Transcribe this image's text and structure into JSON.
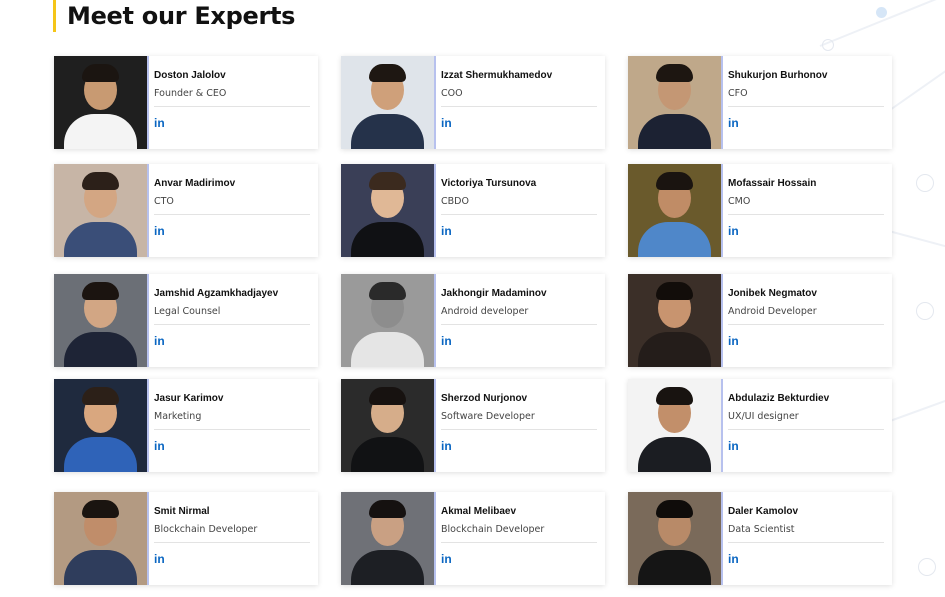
{
  "section": {
    "title": "Meet our Experts"
  },
  "linkedin_icon_text": "in",
  "experts": [
    {
      "name": "Doston Jalolov",
      "role": "Founder & CEO",
      "photo": {
        "bg": "#1f1f1f",
        "body": "#f4f4f4",
        "skin": "#c89a72",
        "hair": "#1b1511"
      }
    },
    {
      "name": "Izzat Shermukhamedov",
      "role": "COO",
      "photo": {
        "bg": "#dfe4ea",
        "body": "#25324a",
        "skin": "#cfa07a",
        "hair": "#1e1712"
      }
    },
    {
      "name": "Shukurjon Burhonov",
      "role": "CFO",
      "photo": {
        "bg": "#bfa88a",
        "body": "#1c2233",
        "skin": "#c49774",
        "hair": "#1d1611"
      }
    },
    {
      "name": "Anvar Madirimov",
      "role": "CTO",
      "photo": {
        "bg": "#c7b5a6",
        "body": "#3a4e78",
        "skin": "#d3a683",
        "hair": "#2c2019"
      }
    },
    {
      "name": "Victoriya Tursunova",
      "role": "CBDO",
      "photo": {
        "bg": "#3a3f57",
        "body": "#101114",
        "skin": "#e0b896",
        "hair": "#3b2a1e"
      }
    },
    {
      "name": "Mofassair Hossain",
      "role": "CMO",
      "photo": {
        "bg": "#6a5a2c",
        "body": "#4f87c9",
        "skin": "#c08c66",
        "hair": "#1a1410"
      }
    },
    {
      "name": "Jamshid Agzamkhadjayev",
      "role": "Legal Counsel",
      "photo": {
        "bg": "#6b6f76",
        "body": "#1e2436",
        "skin": "#d2a684",
        "hair": "#1b1410"
      }
    },
    {
      "name": "Jakhongir Madaminov",
      "role": "Android developer",
      "photo": {
        "bg": "#9a9a9a",
        "body": "#e5e5e5",
        "skin": "#8d8d8d",
        "hair": "#2a2a2a"
      }
    },
    {
      "name": "Jonibek Negmatov",
      "role": "Android Developer",
      "photo": {
        "bg": "#3b2f28",
        "body": "#241d1a",
        "skin": "#c8946f",
        "hair": "#120d0a"
      }
    },
    {
      "name": "Jasur Karimov",
      "role": "Marketing",
      "photo": {
        "bg": "#1f2a3e",
        "body": "#2f63b8",
        "skin": "#d9a77f",
        "hair": "#2c2018"
      }
    },
    {
      "name": "Sherzod Nurjonov",
      "role": "Software Developer",
      "photo": {
        "bg": "#2b2b2b",
        "body": "#111214",
        "skin": "#d6ad8a",
        "hair": "#171210"
      }
    },
    {
      "name": "Abdulaziz Bekturdiev",
      "role": "UX/UI designer",
      "photo": {
        "bg": "#f3f3f3",
        "body": "#1b1d22",
        "skin": "#c28f6a",
        "hair": "#181310"
      }
    },
    {
      "name": "Smit Nirmal",
      "role": "Blockchain Developer",
      "photo": {
        "bg": "#b39a82",
        "body": "#2f3d5c",
        "skin": "#c08d6a",
        "hair": "#1a1410"
      }
    },
    {
      "name": "Akmal Melibaev",
      "role": "Blockchain Developer",
      "photo": {
        "bg": "#6f7177",
        "body": "#1d1f24",
        "skin": "#c9a083",
        "hair": "#151110"
      }
    },
    {
      "name": "Daler Kamolov",
      "role": "Data Scientist",
      "photo": {
        "bg": "#7a6a5a",
        "body": "#151515",
        "skin": "#b88a68",
        "hair": "#0f0c0a"
      }
    }
  ]
}
